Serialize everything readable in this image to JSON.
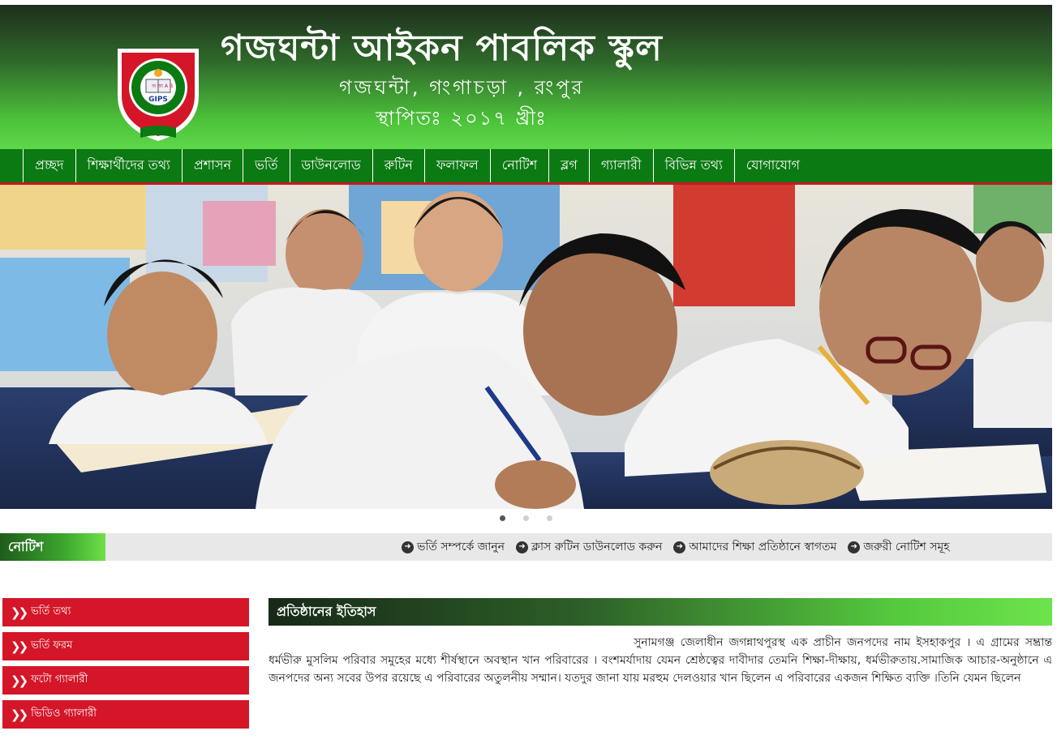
{
  "header": {
    "school_name": "গজঘন্টা আইকন পাবলিক স্কুল",
    "address": "গজঘন্টা, গংগাচড়া , রংপুর",
    "established": "স্থাপিতঃ ২০১৭ খ্রীঃ",
    "logo": {
      "center_letters": "অ আ A B",
      "abbreviation": "GIPS"
    }
  },
  "nav": {
    "items": [
      "প্রচ্ছদ",
      "শিক্ষার্থীদের তথ্য",
      "প্রশাসন",
      "ভর্তি",
      "ডাউনলোড",
      "রুটিন",
      "ফলাফল",
      "নোটিশ",
      "ব্লগ",
      "গ্যালারী",
      "বিভিন্ন তথ্য",
      "যোগাযোগ"
    ]
  },
  "slider": {
    "image": "students-writing-in-classroom",
    "dots": 3,
    "active_dot": 1
  },
  "notice": {
    "label": "নোটিশ",
    "items": [
      "ভর্তি সম্পর্কে জানুন",
      "ক্লাস রুটিন ডাউনলোড করুন",
      "আমাদের শিক্ষা প্রতিষ্ঠানে স্বাগতম",
      "জরুরী নোটিশ সমূহ"
    ]
  },
  "sidebar": {
    "links": [
      "ভর্তি তথ্য",
      "ভর্তি ফরম",
      "ফটো গ্যালারী",
      "ভিডিও গ্যালারী"
    ]
  },
  "main": {
    "heading": "প্রতিষ্ঠানের ইতিহাস",
    "history": "সুনামগঞ্জ জেলাধীন জগন্নাথপুরস্থ এক প্রাচীন জনপদের নাম ইসহাকপুর । এ গ্রামের সম্ভ্রান্ত ধর্মভীরু মুসলিম পরিবার সমুহের মধ্যে শীর্ষস্থানে অবস্থান খান পরিবারের । বংশমর্যাদায় যেমন শ্রেষ্ঠত্বের দাবীদার তেমনি শিক্ষা-দীক্ষায়, ধর্মভীরুতায়.সামাজিক আচার-অনুষ্ঠানে এ জনপদের অন্য সবের উপর রয়েছে এ পরিবারের অতুলনীয় সম্মান। যতদুর জানা যায় মরহুম দেলওয়ার খান ছিলেন এ পরিবারের একজন শিক্ষিত ব্যক্তি ।তিনি যেমন ছিলেন"
  },
  "colors": {
    "nav_green": "#0b7a12",
    "accent_red": "#d41628",
    "header_dark": "#1e2e1e",
    "header_light": "#5ed84a"
  }
}
